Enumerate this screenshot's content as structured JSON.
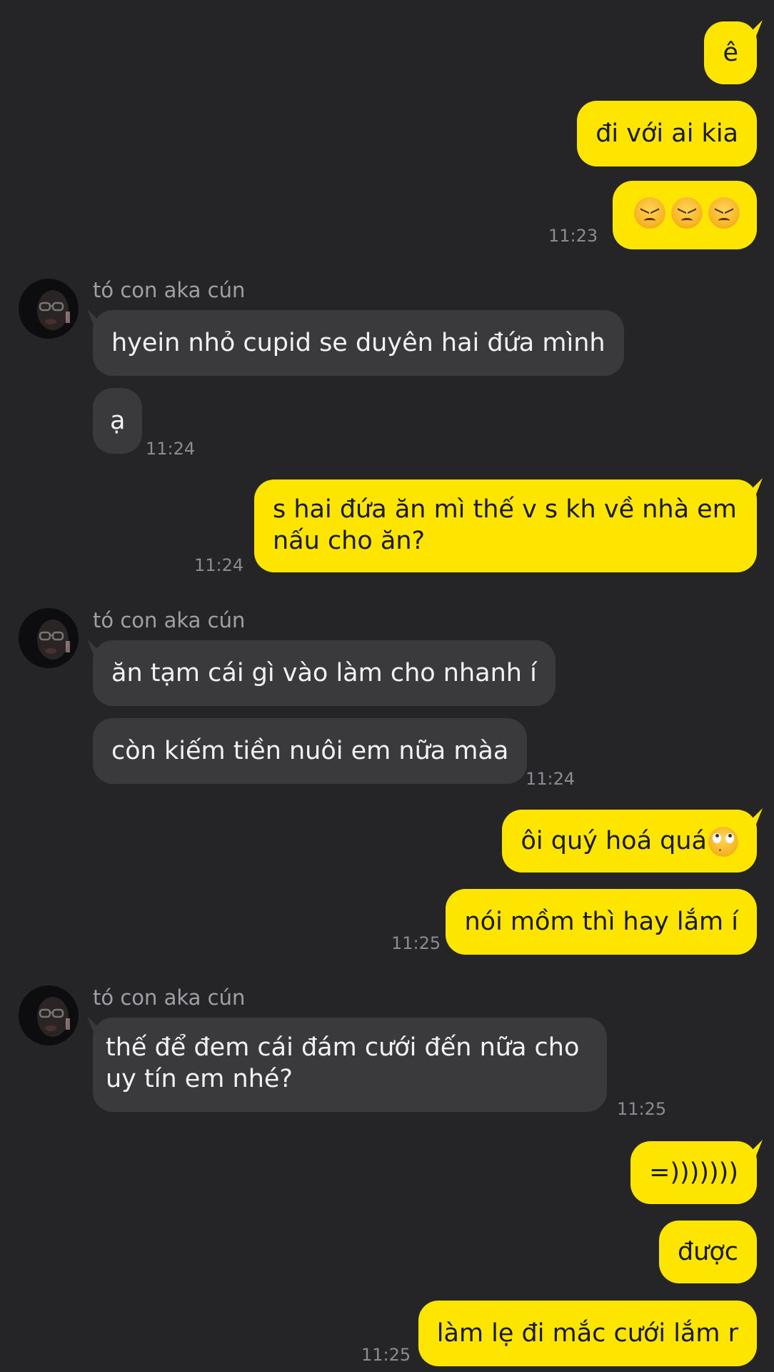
{
  "messages": {
    "m1": "ê",
    "m2": "đi với ai kia",
    "m4": "hyein nhỏ cupid se duyên hai đứa mình",
    "m5": "ạ",
    "m6": "s hai đứa ăn mì thế v s kh về nhà em nấu cho ăn?",
    "m7": "ăn tạm cái gì vào làm cho nhanh í",
    "m8": "còn kiếm tiền nuôi em nữa màa",
    "m9": "ôi quý hoá quá",
    "m10": "nói mồm thì hay lắm í",
    "m11": "thế để đem cái đám cưới đến nữa cho uy tín em nhé?",
    "m12": "=)))))))",
    "m13": "được",
    "m14": "làm lẹ đi mắc cưới lắm r"
  },
  "times": {
    "t1": "11:23",
    "t2": "11:24",
    "t3": "11:24",
    "t4": "11:24",
    "t5": "11:25",
    "t6": "11:25",
    "t7": "11:25"
  },
  "contact": {
    "name": "tó con aka cún"
  },
  "icons": {
    "angry": "angry-face-emoji",
    "roll": "face-with-rolling-eyes-emoji"
  },
  "colors": {
    "background": "#252527",
    "outgoing_bubble": "#fde500",
    "incoming_bubble": "#3a3a3d",
    "timestamp": "#8c8c90"
  }
}
